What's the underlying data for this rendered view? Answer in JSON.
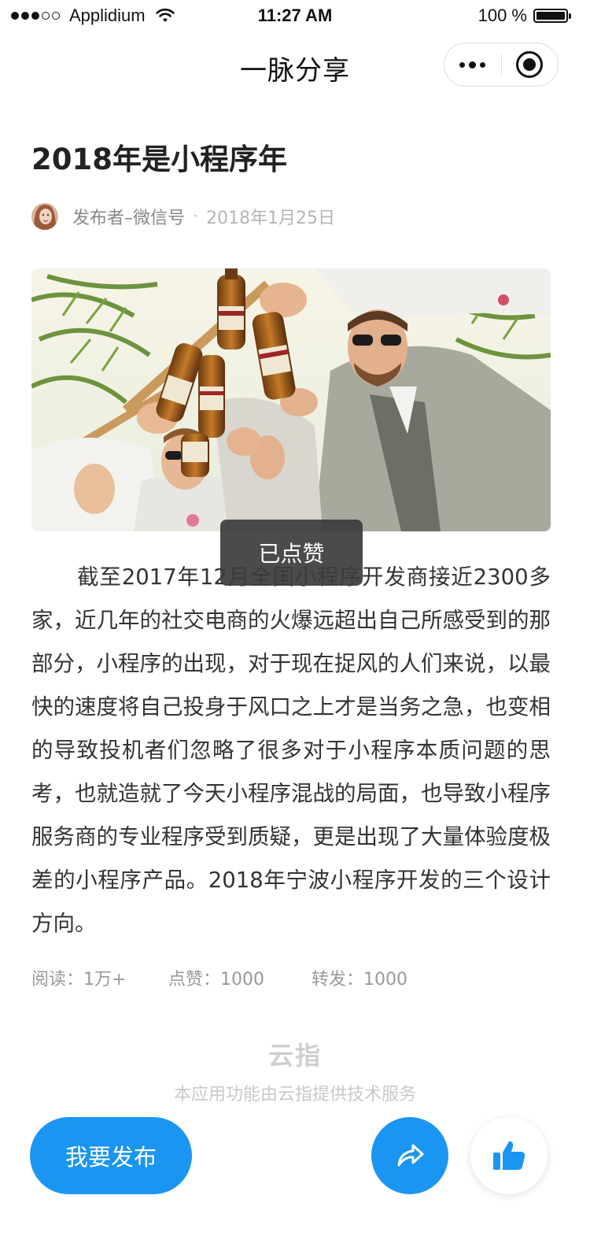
{
  "status_bar": {
    "carrier": "Applidium",
    "time": "11:27 AM",
    "battery": "100 %",
    "signal_bars_filled": 3,
    "signal_bars_total": 5
  },
  "nav": {
    "title": "一脉分享",
    "more_icon": "more-dots-icon",
    "close_icon": "record-circle-icon"
  },
  "article": {
    "title": "2018年是小程序年",
    "author": "发布者–微信号",
    "separator": "·",
    "date": "2018年1月25日",
    "image_description_icon": "photo-image",
    "body": "截至2017年12月全国小程序开发商接近2300多家，近几年的社交电商的火爆远超出自己所感受到的那部分，小程序的出现，对于现在捉风的人们来说，以最快的速度将自己投身于风口之上才是当务之急，也变相的导致投机者们忽略了很多对于小程序本质问题的思考，也就造就了今天小程序混战的局面，也导致小程序服务商的专业程序受到质疑，更是出现了大量体验度极差的小程序产品。2018年宁波小程序开发的三个设计方向。"
  },
  "toast": {
    "text": "已点赞"
  },
  "stats": {
    "reads": "阅读：1万+",
    "likes": "点赞：1000",
    "shares": "转发：1000"
  },
  "footer": {
    "brand": "云指",
    "powered_by": "本应用功能由云指提供技术服务"
  },
  "actions": {
    "publish_label": "我要发布",
    "share_icon": "share-arrow-icon",
    "like_icon": "thumbs-up-icon"
  },
  "colors": {
    "accent": "#1a96f2",
    "text_primary": "#333333",
    "text_muted": "#9a9a9a",
    "toast_bg": "#3c3c3c"
  }
}
